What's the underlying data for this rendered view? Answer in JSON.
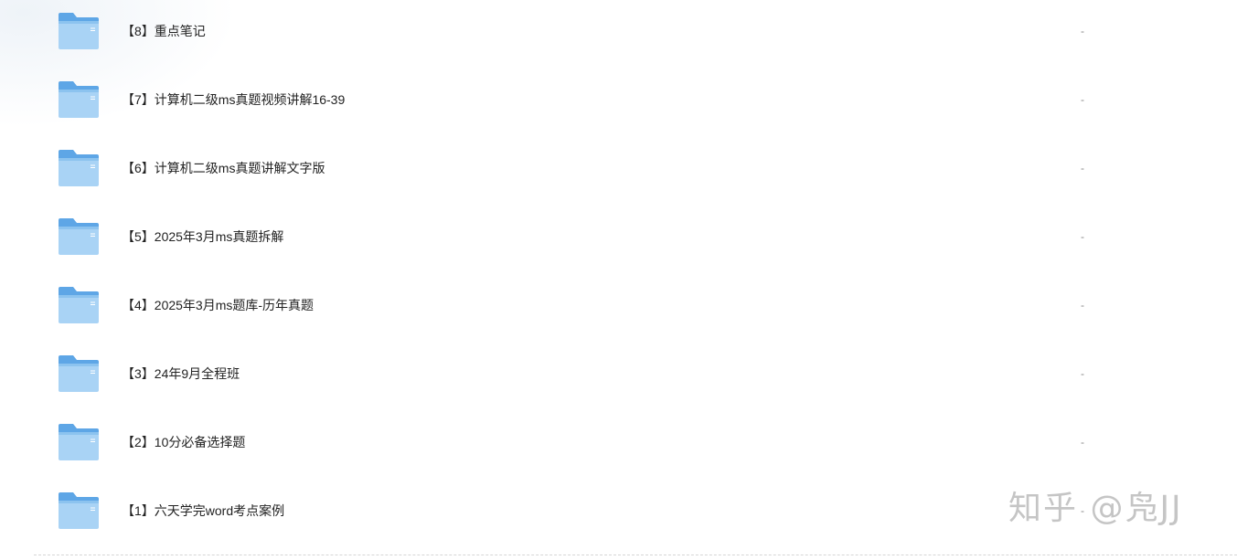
{
  "files": [
    {
      "name": "【8】重点笔记",
      "meta": "-",
      "icon": "folder-icon"
    },
    {
      "name": "【7】计算机二级ms真题视频讲解16-39",
      "meta": "-",
      "icon": "folder-icon"
    },
    {
      "name": "【6】计算机二级ms真题讲解文字版",
      "meta": "-",
      "icon": "folder-icon"
    },
    {
      "name": "【5】2025年3月ms真题拆解",
      "meta": "-",
      "icon": "folder-icon"
    },
    {
      "name": "【4】2025年3月ms题库-历年真题",
      "meta": "-",
      "icon": "folder-icon"
    },
    {
      "name": "【3】24年9月全程班",
      "meta": "-",
      "icon": "folder-icon"
    },
    {
      "name": "【2】10分必备选择题",
      "meta": "-",
      "icon": "folder-icon"
    },
    {
      "name": "【1】六天学完word考点案例",
      "meta": "-",
      "icon": "folder-icon"
    }
  ],
  "watermark": {
    "text": "知乎 @凫JJ"
  },
  "colors": {
    "folder_light": "#b3d8f5",
    "folder_dark": "#5ea6e6",
    "text": "#222222",
    "muted": "#888888"
  }
}
